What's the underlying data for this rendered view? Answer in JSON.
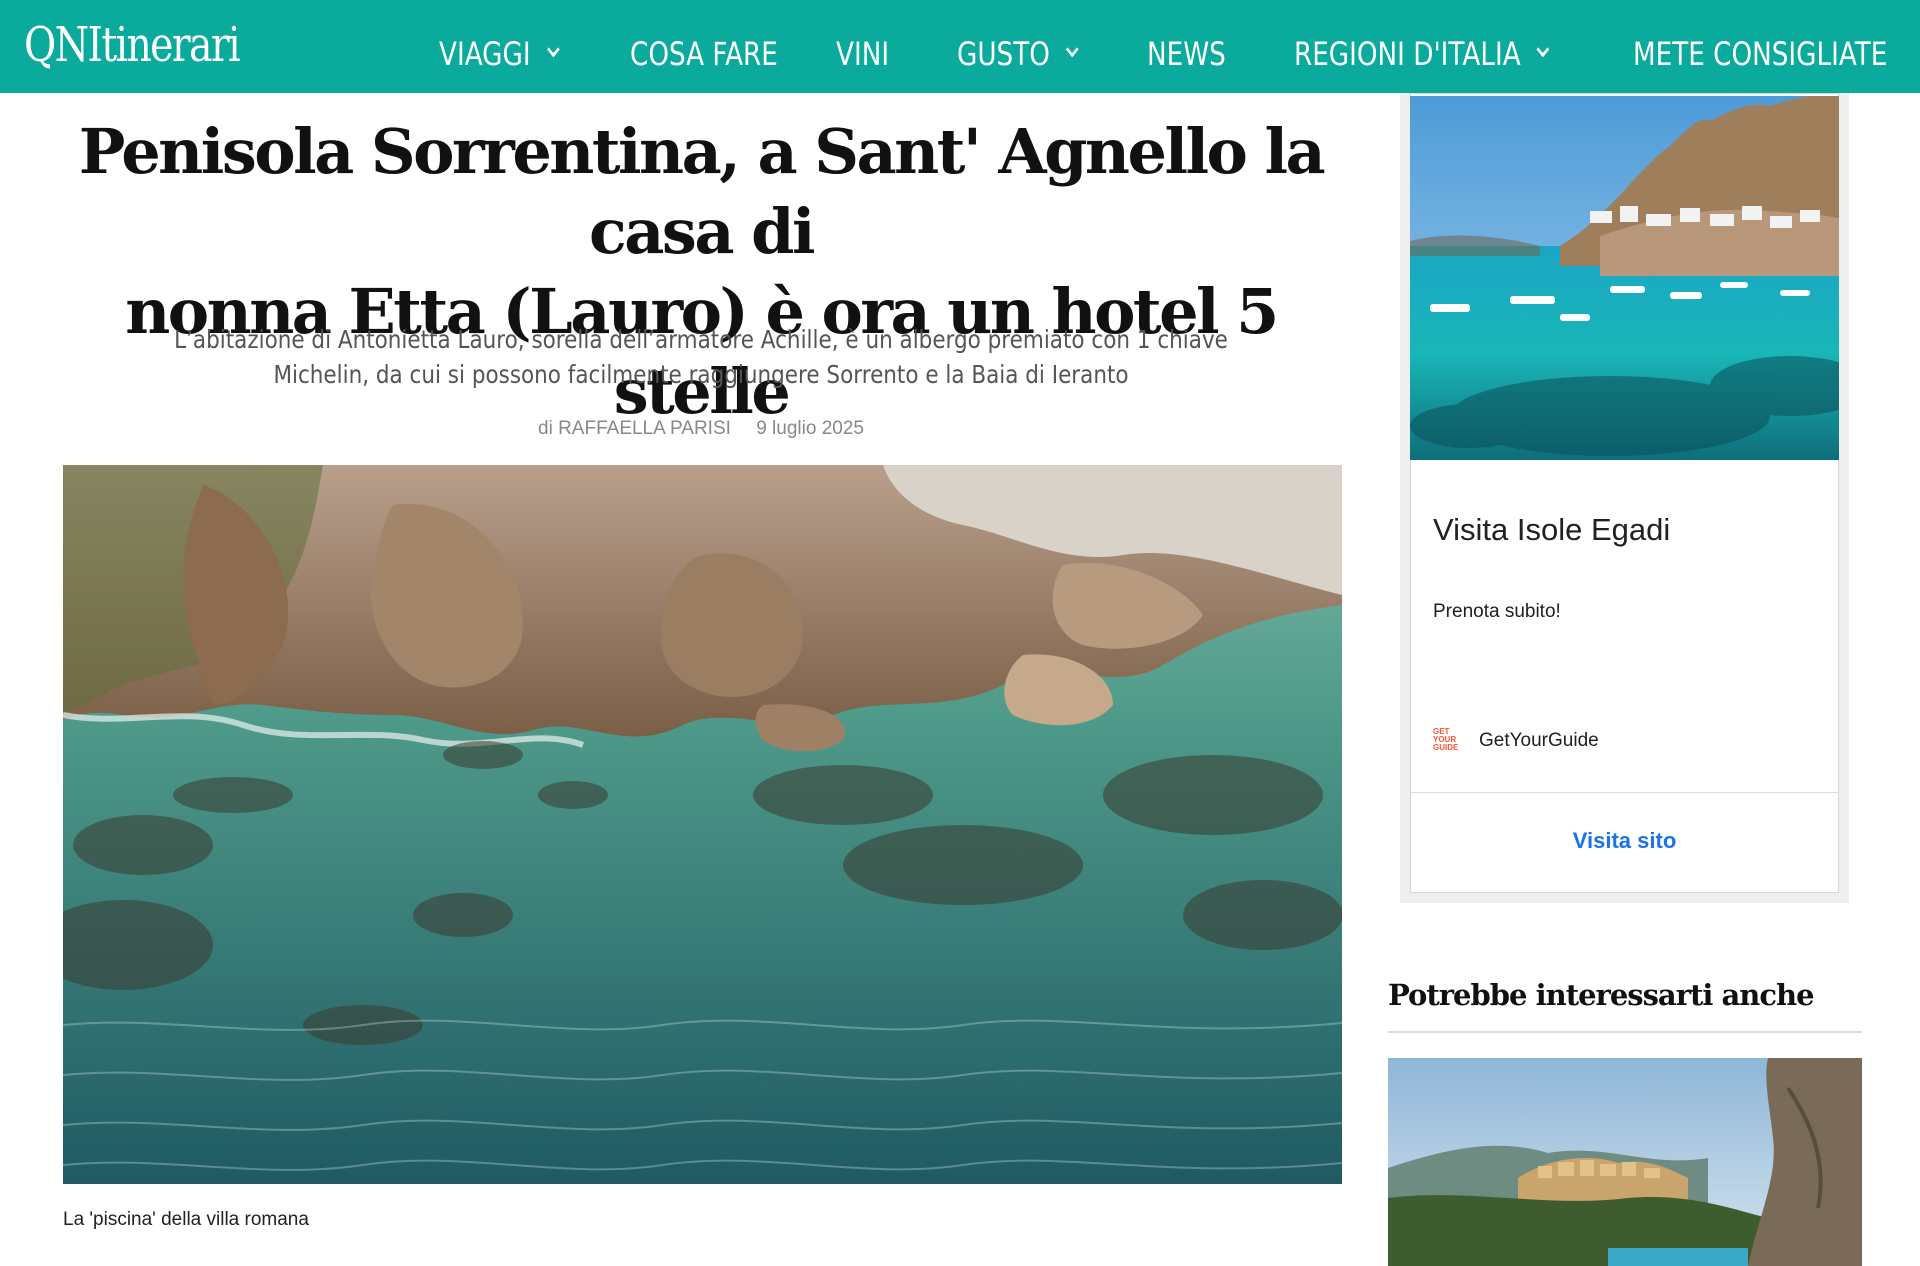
{
  "header": {
    "logo": "QNItinerari",
    "nav": [
      {
        "label": "VIAGGI",
        "has_dropdown": true
      },
      {
        "label": "COSA FARE",
        "has_dropdown": false
      },
      {
        "label": "VINI",
        "has_dropdown": false
      },
      {
        "label": "GUSTO",
        "has_dropdown": true
      },
      {
        "label": "NEWS",
        "has_dropdown": false
      },
      {
        "label": "REGIONI D'ITALIA",
        "has_dropdown": true
      },
      {
        "label": "METE CONSIGLIATE",
        "has_dropdown": false
      }
    ],
    "bar_color": "#0aab9c"
  },
  "article": {
    "headline_line1": "Penisola Sorrentina, a Sant' Agnello la casa di",
    "headline_line2": "nonna Etta (Lauro) è ora un hotel 5 stelle",
    "subtitle": "L’abitazione di Antonietta Lauro, sorella dell’armatore Achille, è un albergo premiato con 1 chiave Michelin, da cui si possono facilmente raggiungere Sorrento e la Baia di Ieranto",
    "author": "di RAFFAELLA PARISI",
    "date": "9 luglio 2025",
    "image_caption": "La 'piscina' della villa romana"
  },
  "ad": {
    "title": "Visita Isole Egadi",
    "description": "Prenota subito!",
    "brand": "GetYourGuide",
    "brand_logo": "GET YOUR GUIDE",
    "cta": "Visita sito",
    "cta_color": "#1a73e8"
  },
  "related": {
    "title": "Potrebbe interessarti anche"
  }
}
